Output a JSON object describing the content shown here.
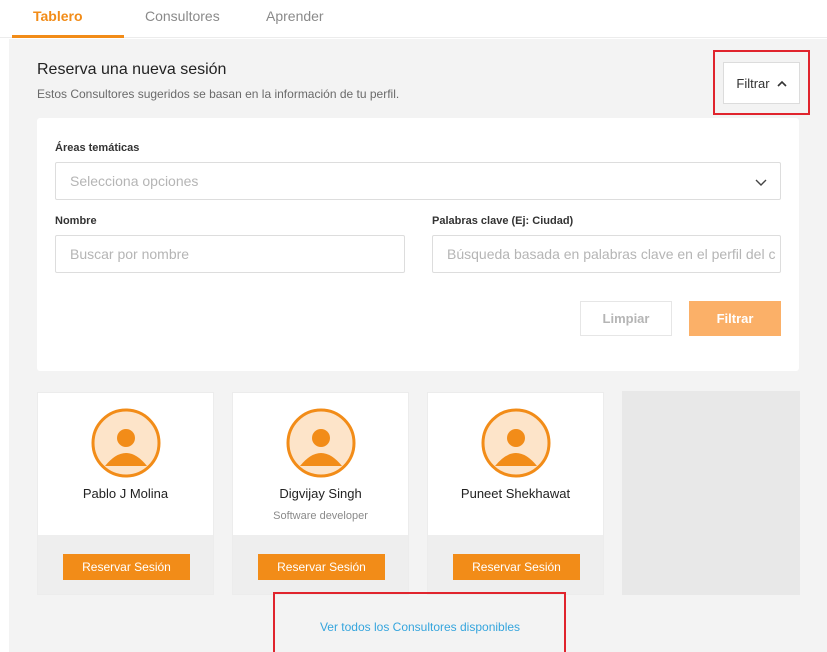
{
  "tabs": [
    {
      "label": "Tablero",
      "active": true
    },
    {
      "label": "Consultores",
      "active": false
    },
    {
      "label": "Aprender",
      "active": false
    }
  ],
  "section": {
    "title": "Reserva una nueva sesión",
    "subtitle": "Estos Consultores sugeridos se basan en la información de tu perfil."
  },
  "filter_toggle": {
    "label": "Filtrar",
    "icon": "chevron-up-icon"
  },
  "filters": {
    "areas_label": "Áreas temáticas",
    "areas_placeholder": "Selecciona opciones",
    "name_label": "Nombre",
    "name_placeholder": "Buscar por nombre",
    "keywords_label": "Palabras clave (Ej: Ciudad)",
    "keywords_placeholder": "Búsqueda basada en palabras clave en el perfil del c",
    "clear_label": "Limpiar",
    "filter_label": "Filtrar"
  },
  "consultants": [
    {
      "name": "Pablo J Molina",
      "role": "",
      "button": "Reservar Sesión"
    },
    {
      "name": "Digvijay Singh",
      "role": "Software developer",
      "button": "Reservar Sesión"
    },
    {
      "name": "Puneet Shekhawat",
      "role": "",
      "button": "Reservar Sesión"
    }
  ],
  "view_all_label": "Ver todos los Consultores disponibles",
  "colors": {
    "accent": "#f28c18",
    "accent_light": "#fbb068",
    "link": "#35a5dd",
    "highlight": "#e0242d"
  }
}
